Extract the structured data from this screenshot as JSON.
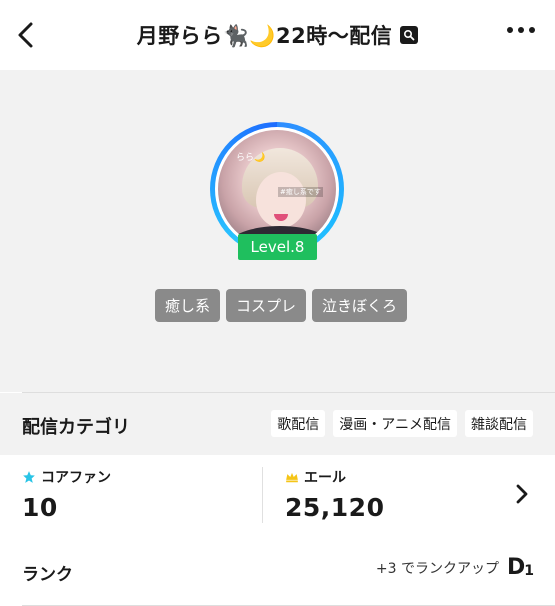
{
  "header": {
    "title": "月野らら🐈‍⬛🌙22時〜配信",
    "search_icon": "search-icon",
    "back_icon": "chevron-left-icon",
    "more_icon": "more-horizontal-icon"
  },
  "profile": {
    "avatar_caption_top": "らら🌙",
    "avatar_caption_mid": "#癒し系です",
    "level": "Level.8",
    "level_color": "#1fbf5e",
    "ring_color": "#2e8cff",
    "tags": [
      "癒し系",
      "コスプレ",
      "泣きぼくろ"
    ]
  },
  "category": {
    "label": "配信カテゴリ",
    "chips": [
      "歌配信",
      "漫画・アニメ配信",
      "雑談配信"
    ]
  },
  "stats": {
    "core_fan_label": "コアファン",
    "core_fan_value": "10",
    "core_fan_icon": "star-icon",
    "core_fan_icon_color": "#29c4e6",
    "yell_label": "エール",
    "yell_value": "25,120",
    "yell_icon": "crown-icon",
    "yell_icon_color": "#f5c518"
  },
  "rank": {
    "label": "ランク",
    "up_text": "+3 でランクアップ",
    "letter": "D",
    "sub": "1"
  }
}
